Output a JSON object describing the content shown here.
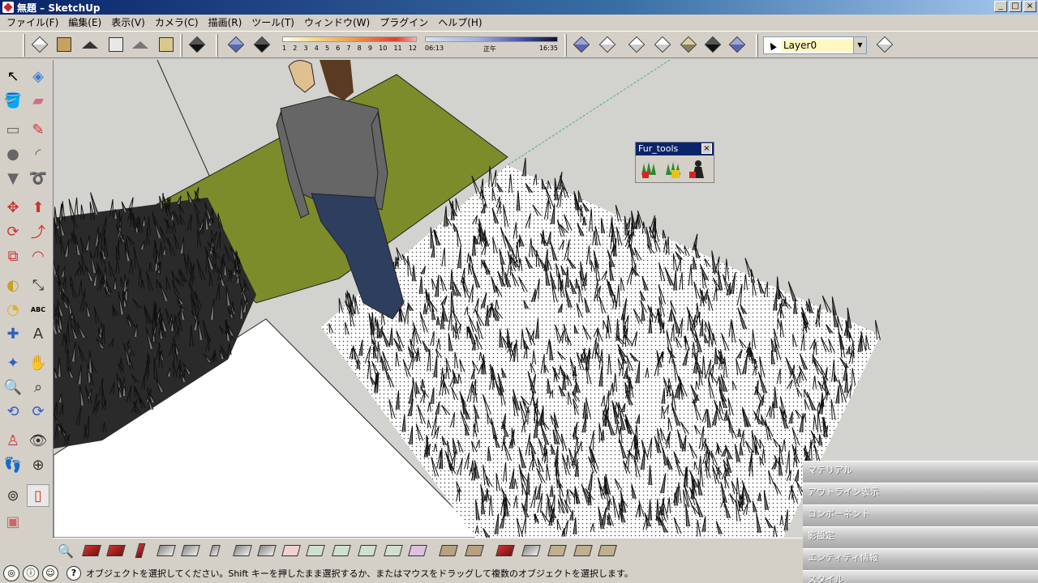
{
  "window": {
    "title": "無題 – SketchUp",
    "controls": [
      "_",
      "□",
      "×"
    ]
  },
  "menu": [
    "ファイル(F)",
    "編集(E)",
    "表示(V)",
    "カメラ(C)",
    "描画(R)",
    "ツール(T)",
    "ウィンドウ(W)",
    "プラグイン",
    "ヘルプ(H)"
  ],
  "shadow": {
    "month_labels": [
      "1",
      "2",
      "3",
      "4",
      "5",
      "6",
      "7",
      "8",
      "9",
      "10",
      "11",
      "12"
    ],
    "time_start": "06:13",
    "time_noon": "正午",
    "time_end": "16:35"
  },
  "layer": {
    "current": "Layer0"
  },
  "fur_tools": {
    "title": "Fur_tools",
    "close": "×"
  },
  "right_panels": [
    "マテリアル",
    "アウトライン表示",
    "コンポーネント",
    "影設定",
    "エンティティ情報",
    "スタイル"
  ],
  "status": {
    "help": "?",
    "message": "オブジェクトを選択してください。Shift キーを押したまま選択するか、またはマウスをドラッグして複数のオブジェクトを選択します。"
  },
  "left_toolbar_text": {
    "abc": "ABC"
  },
  "colors": {
    "title_bar": "#0a246a",
    "chrome": "#d4d0c8",
    "ground_green": "#7d8c2a",
    "canvas_bg": "#d2d2ce"
  }
}
